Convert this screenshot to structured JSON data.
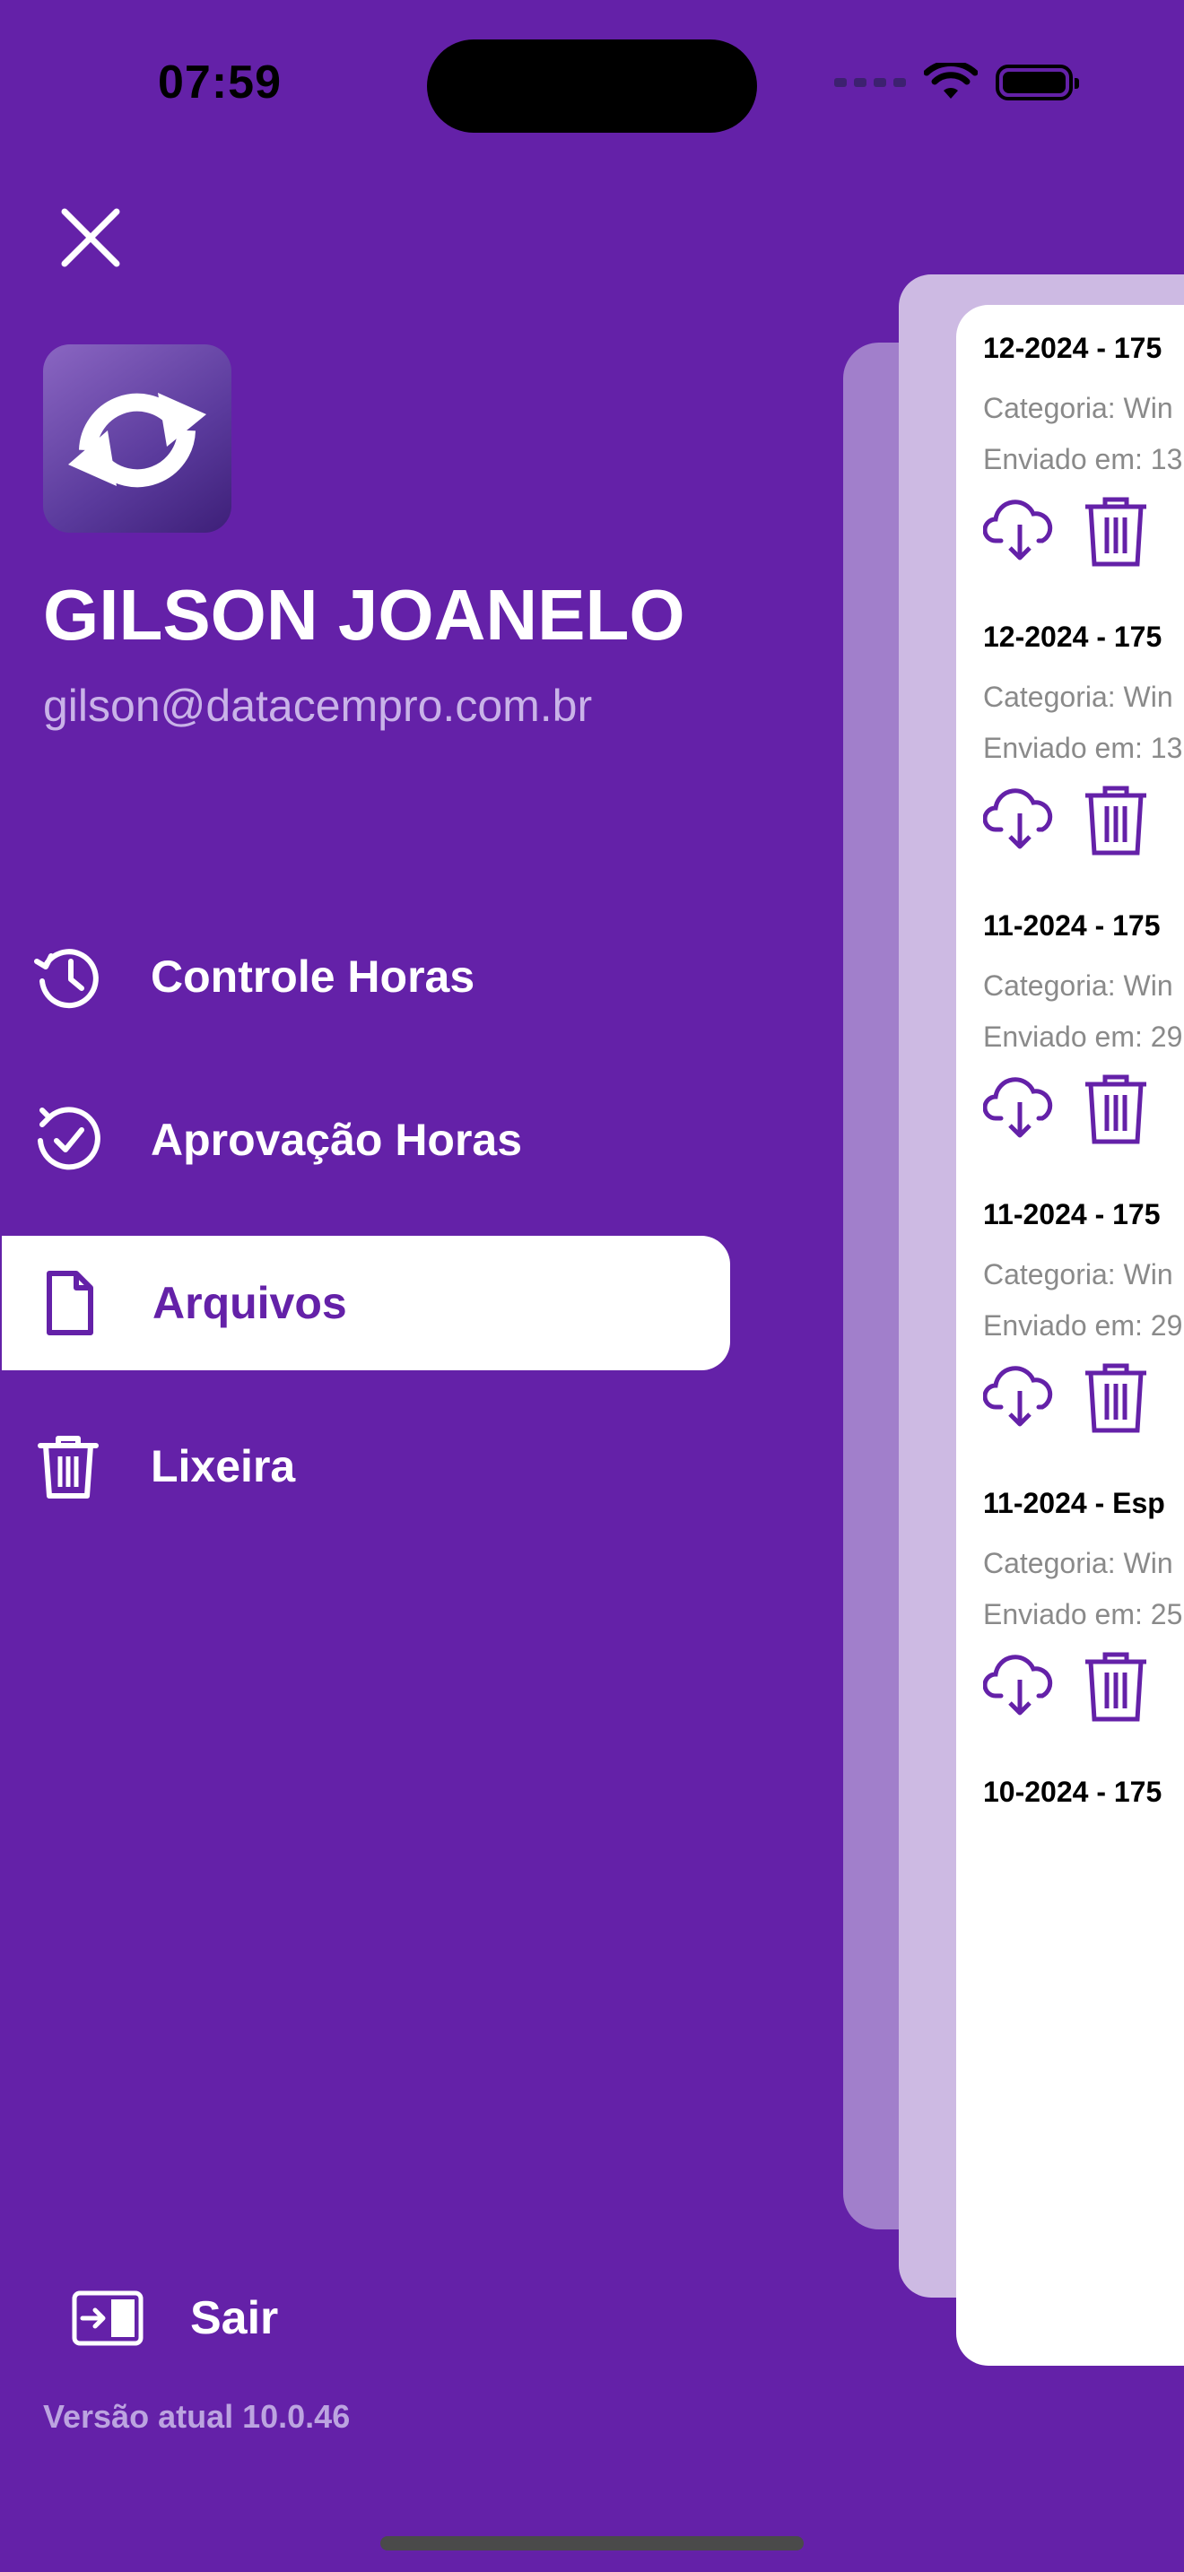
{
  "status_bar": {
    "time": "07:59"
  },
  "drawer": {
    "close_icon": "close-icon",
    "logo_icon": "sync-arrows-icon",
    "user_name": "GILSON JOANELO",
    "user_email": "gilson@datacempro.com.br",
    "menu": [
      {
        "label": "Controle Horas",
        "icon": "history-clock-icon",
        "active": false
      },
      {
        "label": "Aprovação Horas",
        "icon": "check-refresh-icon",
        "active": false
      },
      {
        "label": "Arquivos",
        "icon": "file-icon",
        "active": true
      },
      {
        "label": "Lixeira",
        "icon": "trash-icon",
        "active": false
      }
    ],
    "logout_label": "Sair",
    "version": "Versão atual 10.0.46"
  },
  "files_panel": {
    "cards": [
      {
        "title": "12-2024 - 175",
        "category": "Categoria: Win",
        "sent": "Enviado em: 13"
      },
      {
        "title": "12-2024 - 175",
        "category": "Categoria: Win",
        "sent": "Enviado em: 13"
      },
      {
        "title": "11-2024 - 175",
        "category": "Categoria: Win",
        "sent": "Enviado em: 29"
      },
      {
        "title": "11-2024 - 175",
        "category": "Categoria: Win",
        "sent": "Enviado em: 29"
      },
      {
        "title": "11-2024 - Esp",
        "category": "Categoria: Win",
        "sent": "Enviado em: 25"
      },
      {
        "title": "10-2024 - 175",
        "category": "",
        "sent": ""
      }
    ]
  },
  "colors": {
    "background": "#6421a8",
    "accent": "#6421a8",
    "muted_text": "#c9b3e8"
  }
}
